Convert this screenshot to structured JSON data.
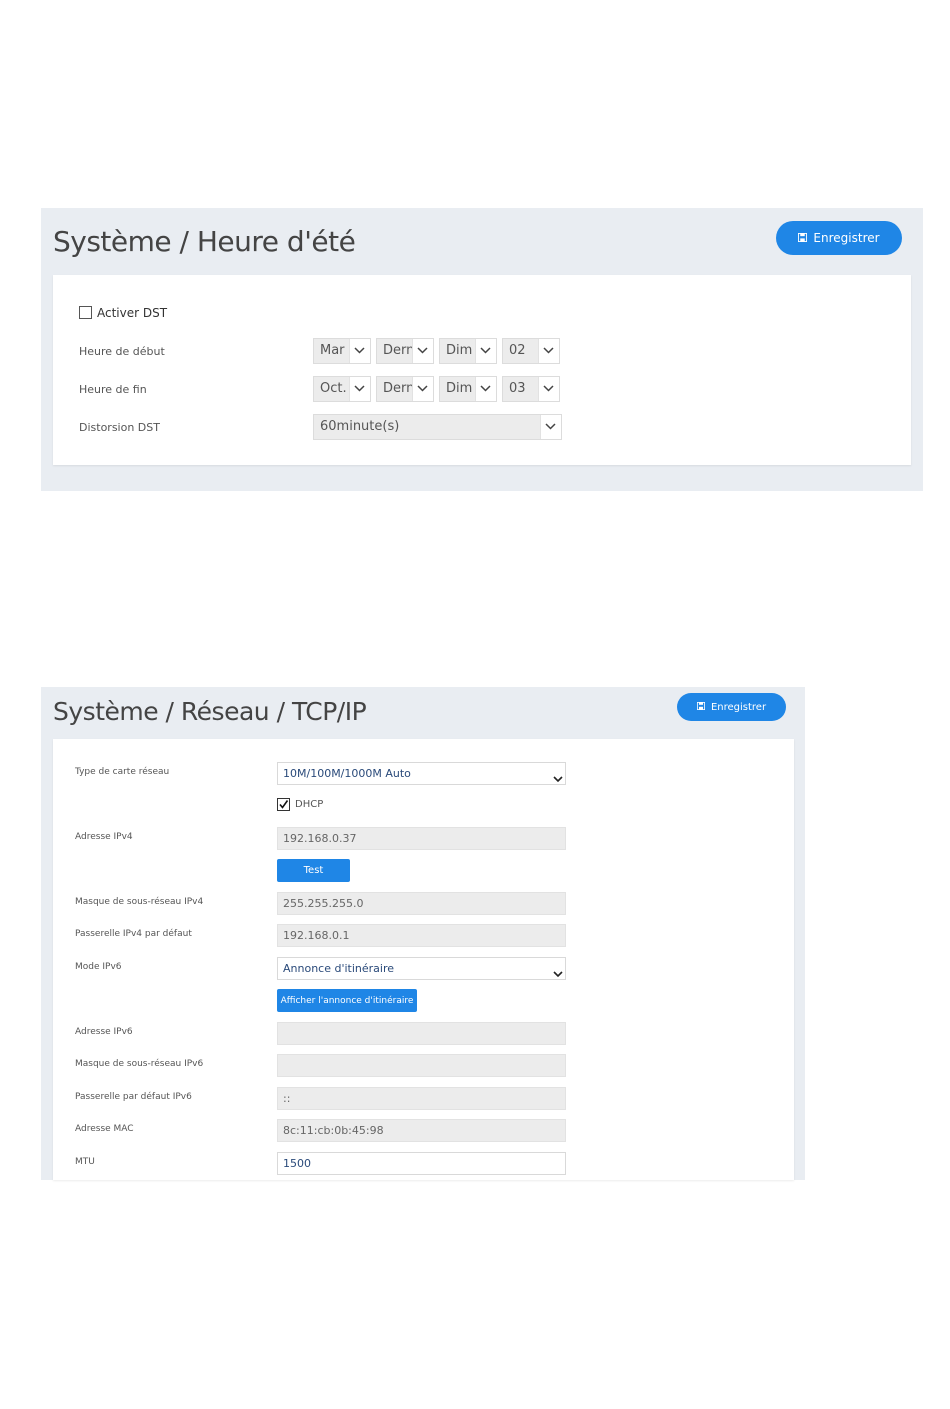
{
  "dst": {
    "title": "Système / Heure d'été",
    "save_label": "Enregistrer",
    "enable_label": "Activer DST",
    "enable_checked": false,
    "start_label": "Heure de début",
    "start": {
      "month": "Mar",
      "week": "Dernié",
      "day": "Dim",
      "hour": "02"
    },
    "end_label": "Heure de fin",
    "end": {
      "month": "Oct.",
      "week": "Dernié",
      "day": "Dim",
      "hour": "03"
    },
    "bias_label": "Distorsion DST",
    "bias_value": "60minute(s)"
  },
  "tcpip": {
    "title": "Système / Réseau / TCP/IP",
    "save_label": "Enregistrer",
    "nic_type_label": "Type de carte réseau",
    "nic_type_value": "10M/100M/1000M Auto",
    "dhcp_label": "DHCP",
    "dhcp_checked": true,
    "ipv4_label": "Adresse IPv4",
    "ipv4_value": "192.168.0.37",
    "test_label": "Test",
    "ipv4_mask_label": "Masque de sous-réseau IPv4",
    "ipv4_mask_value": "255.255.255.0",
    "ipv4_gateway_label": "Passerelle IPv4 par défaut",
    "ipv4_gateway_value": "192.168.0.1",
    "ipv6_mode_label": "Mode IPv6",
    "ipv6_mode_value": "Annonce d'itinéraire",
    "show_ra_label": "Afficher l'annonce d'itinéraire",
    "ipv6_label": "Adresse IPv6",
    "ipv6_value": "",
    "ipv6_mask_label": "Masque de sous-réseau IPv6",
    "ipv6_mask_value": "",
    "ipv6_gateway_label": "Passerelle par défaut IPv6",
    "ipv6_gateway_value": "::",
    "mac_label": "Adresse MAC",
    "mac_value": "8c:11:cb:0b:45:98",
    "mtu_label": "MTU",
    "mtu_value": "1500"
  },
  "colors": {
    "accent": "#1f86e6",
    "panel_bg": "#e9edf2"
  }
}
